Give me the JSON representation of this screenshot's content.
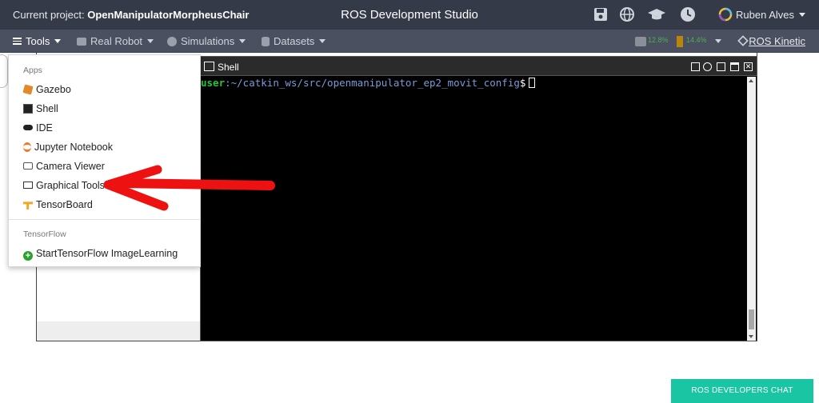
{
  "topbar": {
    "project_prefix": "Current project:",
    "project_name": "OpenManipulatorMorpheusChair",
    "app_title": "ROS Development Studio",
    "user_name": "Ruben Alves",
    "icons": [
      "save-icon",
      "globe-icon",
      "graduation-cap-icon",
      "clock-icon",
      "avatar"
    ]
  },
  "secondary_bar": {
    "tools": "Tools",
    "real_robot": "Real Robot",
    "simulations": "Simulations",
    "datasets": "Datasets",
    "ros_version": "ROS Kinetic",
    "cpu_stat": "12.8%",
    "mem_stat": "14.4%"
  },
  "dropdown": {
    "apps_header": "Apps",
    "items": [
      {
        "label": "Gazebo",
        "icon": "gazebo-icon"
      },
      {
        "label": "Shell",
        "icon": "terminal-icon"
      },
      {
        "label": "IDE",
        "icon": "ide-icon"
      },
      {
        "label": "Jupyter Notebook",
        "icon": "jupyter-icon"
      },
      {
        "label": "Camera Viewer",
        "icon": "camera-icon"
      },
      {
        "label": "Graphical Tools",
        "icon": "monitor-icon"
      },
      {
        "label": "TensorBoard",
        "icon": "tensorboard-icon"
      }
    ],
    "tf_header": "TensorFlow",
    "tf_item": "StartTensorFlow ImageLearning"
  },
  "shell": {
    "title": "Shell",
    "prompt_user": "user",
    "prompt_path": ":~/catkin_ws/src/openmanipulator_ep2_movit_config",
    "prompt_symbol": "$"
  },
  "chat_button": "ROS DEVELOPERS CHAT",
  "colors": {
    "topbar": "#353a48",
    "secbar": "#4a5060",
    "chat": "#1ac5a3",
    "annotation_arrow": "#ee1111"
  }
}
